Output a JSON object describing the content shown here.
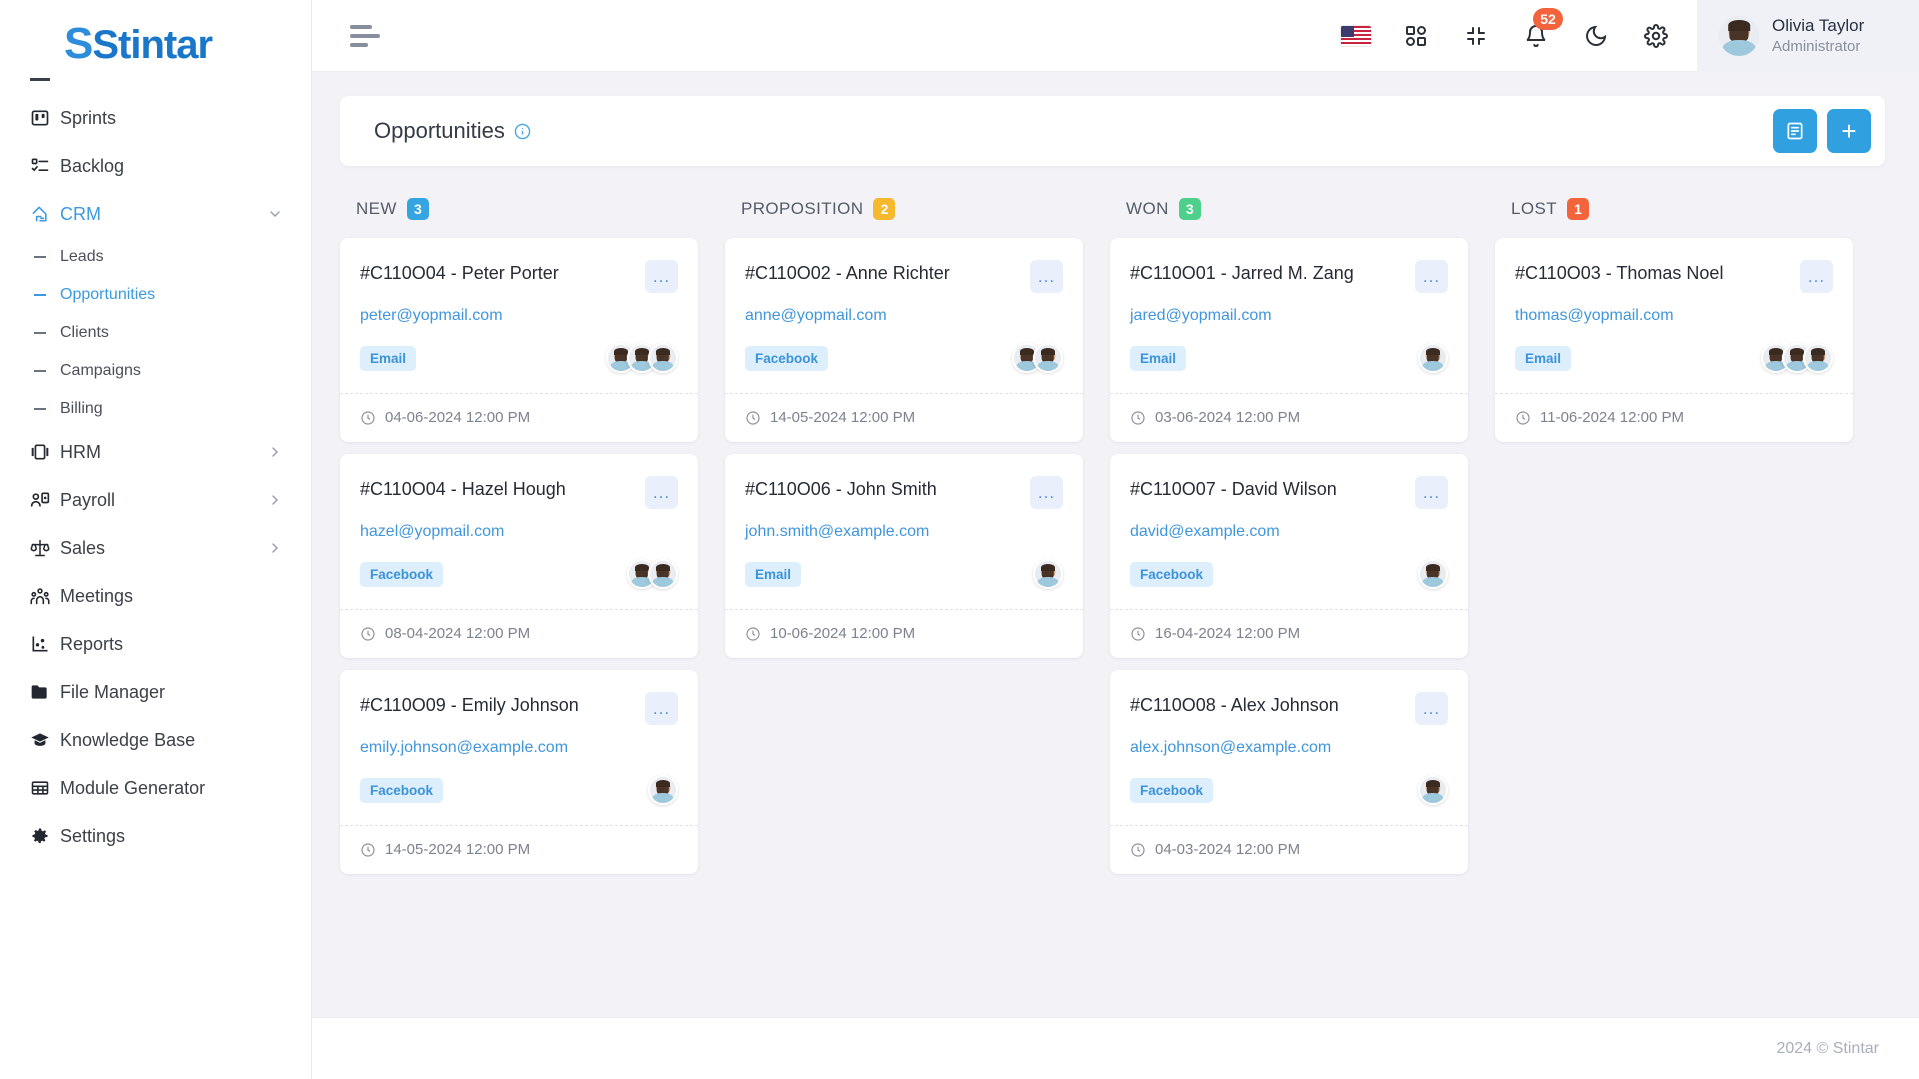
{
  "brand": {
    "name": "Stintar"
  },
  "sidebar": {
    "items": [
      {
        "label": "Sprints",
        "icon": "sprints-icon",
        "type": "item",
        "active": false,
        "expandable": false
      },
      {
        "label": "Backlog",
        "icon": "backlog-icon",
        "type": "item",
        "active": false,
        "expandable": false
      },
      {
        "label": "CRM",
        "icon": "crm-icon",
        "type": "item",
        "active": true,
        "expandable": true,
        "expanded": true
      },
      {
        "label": "Leads",
        "type": "sub",
        "active": false
      },
      {
        "label": "Opportunities",
        "type": "sub",
        "active": true
      },
      {
        "label": "Clients",
        "type": "sub",
        "active": false
      },
      {
        "label": "Campaigns",
        "type": "sub",
        "active": false
      },
      {
        "label": "Billing",
        "type": "sub",
        "active": false
      },
      {
        "label": "HRM",
        "icon": "hrm-icon",
        "type": "item",
        "active": false,
        "expandable": true
      },
      {
        "label": "Payroll",
        "icon": "payroll-icon",
        "type": "item",
        "active": false,
        "expandable": true
      },
      {
        "label": "Sales",
        "icon": "sales-icon",
        "type": "item",
        "active": false,
        "expandable": true
      },
      {
        "label": "Meetings",
        "icon": "meetings-icon",
        "type": "item",
        "active": false,
        "expandable": false
      },
      {
        "label": "Reports",
        "icon": "reports-icon",
        "type": "item",
        "active": false,
        "expandable": false
      },
      {
        "label": "File Manager",
        "icon": "folder-icon",
        "type": "item",
        "active": false,
        "expandable": false
      },
      {
        "label": "Knowledge Base",
        "icon": "graduation-cap-icon",
        "type": "item",
        "active": false,
        "expandable": false
      },
      {
        "label": "Module Generator",
        "icon": "grid-table-icon",
        "type": "item",
        "active": false,
        "expandable": false
      },
      {
        "label": "Settings",
        "icon": "gear-icon",
        "type": "item",
        "active": false,
        "expandable": false
      }
    ]
  },
  "topbar": {
    "menu_icon": "hamburger-icon",
    "icons": [
      {
        "name": "language-flag-icon",
        "label": "US"
      },
      {
        "name": "apps-grid-icon",
        "label": ""
      },
      {
        "name": "fullscreen-collapse-icon",
        "label": ""
      },
      {
        "name": "notification-bell-icon",
        "label": "",
        "badge": "52"
      },
      {
        "name": "dark-mode-moon-icon",
        "label": ""
      },
      {
        "name": "settings-gear-icon",
        "label": ""
      }
    ],
    "notification_count": "52",
    "user": {
      "name": "Olivia Taylor",
      "role": "Administrator",
      "avatar": "user-avatar"
    }
  },
  "page": {
    "title": "Opportunities",
    "info_icon": "info-circle-icon",
    "actions": [
      {
        "name": "list-view-button",
        "icon": "list-view-icon"
      },
      {
        "name": "add-opportunity-button",
        "icon": "plus-icon",
        "label": "+"
      }
    ]
  },
  "board": {
    "columns": [
      {
        "name": "NEW",
        "count": "3",
        "color": "#34a5e0",
        "cards": [
          {
            "title": "#C110O04 - Peter Porter",
            "email": "peter@yopmail.com",
            "tag": "Email",
            "date": "04-06-2024 12:00 PM",
            "avatars": 3,
            "menu": "..."
          },
          {
            "title": "#C110O04 - Hazel Hough",
            "email": "hazel@yopmail.com",
            "tag": "Facebook",
            "date": "08-04-2024 12:00 PM",
            "avatars": 2,
            "menu": "..."
          },
          {
            "title": "#C110O09 - Emily Johnson",
            "email": "emily.johnson@example.com",
            "tag": "Facebook",
            "date": "14-05-2024 12:00 PM",
            "avatars": 1,
            "menu": "..."
          }
        ]
      },
      {
        "name": "PROPOSITION",
        "count": "2",
        "color": "#f5b82e",
        "cards": [
          {
            "title": "#C110O02 - Anne Richter",
            "email": "anne@yopmail.com",
            "tag": "Facebook",
            "date": "14-05-2024 12:00 PM",
            "avatars": 2,
            "menu": "..."
          },
          {
            "title": "#C110O06 - John Smith",
            "email": "john.smith@example.com",
            "tag": "Email",
            "date": "10-06-2024 12:00 PM",
            "avatars": 1,
            "menu": "..."
          }
        ]
      },
      {
        "name": "WON",
        "count": "3",
        "color": "#4ed08a",
        "cards": [
          {
            "title": "#C110O01 - Jarred M. Zang",
            "email": "jared@yopmail.com",
            "tag": "Email",
            "date": "03-06-2024 12:00 PM",
            "avatars": 1,
            "menu": "..."
          },
          {
            "title": "#C110O07 - David Wilson",
            "email": "david@example.com",
            "tag": "Facebook",
            "date": "16-04-2024 12:00 PM",
            "avatars": 1,
            "menu": "..."
          },
          {
            "title": "#C110O08 - Alex Johnson",
            "email": "alex.johnson@example.com",
            "tag": "Facebook",
            "date": "04-03-2024 12:00 PM",
            "avatars": 1,
            "menu": "..."
          }
        ]
      },
      {
        "name": "LOST",
        "count": "1",
        "color": "#f4643c",
        "cards": [
          {
            "title": "#C110O03 - Thomas Noel",
            "email": "thomas@yopmail.com",
            "tag": "Email",
            "date": "11-06-2024 12:00 PM",
            "avatars": 3,
            "menu": "..."
          }
        ]
      }
    ]
  },
  "footer": {
    "copyright": "2024 © Stintar"
  },
  "colors": {
    "accent": "#30a0e0",
    "link": "#4096dd",
    "badge_new": "#34a5e0",
    "badge_proposition": "#f5b82e",
    "badge_won": "#4ed08a",
    "badge_lost": "#f4643c",
    "notification": "#f4643c"
  }
}
